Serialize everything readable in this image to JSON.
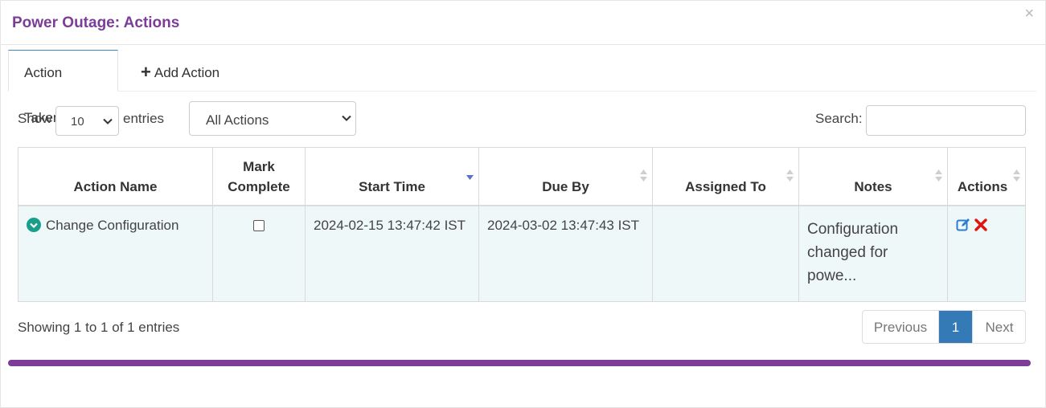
{
  "modal": {
    "title": "Power Outage: Actions",
    "close_glyph": "×"
  },
  "tabs": [
    {
      "label": "Action Taken",
      "active": true
    },
    {
      "label": "Add Action",
      "icon": "plus-icon"
    }
  ],
  "controls": {
    "show_label": "Show",
    "entries_value": "10",
    "entries_label": "entries",
    "filter_value": "All Actions",
    "search_label": "Search:",
    "search_value": ""
  },
  "table": {
    "columns": [
      {
        "label": "Action Name"
      },
      {
        "label": "Mark Complete"
      },
      {
        "label": "Start Time",
        "sorted": "desc"
      },
      {
        "label": "Due By"
      },
      {
        "label": "Assigned To"
      },
      {
        "label": "Notes"
      },
      {
        "label": "Actions"
      }
    ],
    "rows": [
      {
        "action_name": "Change Configuration",
        "status_icon": "check-circle-icon",
        "mark_complete": false,
        "start_time": "2024-02-15 13:47:42 IST",
        "due_by": "2024-03-02 13:47:43 IST",
        "assigned_to": "",
        "notes": "Configuration changed for powe...",
        "actions": [
          "edit-icon",
          "delete-icon"
        ]
      }
    ]
  },
  "footer": {
    "info": "Showing 1 to 1 of 1 entries",
    "pagination": {
      "previous": "Previous",
      "current": "1",
      "next": "Next"
    }
  },
  "colors": {
    "title": "#7b3d97",
    "accent_bar": "#7b3d97",
    "active_page": "#337ab7",
    "row_bg": "#eef8f8",
    "check_circle": "#1a9e8c",
    "delete": "#e3120b",
    "edit": "#2b7dd0"
  }
}
